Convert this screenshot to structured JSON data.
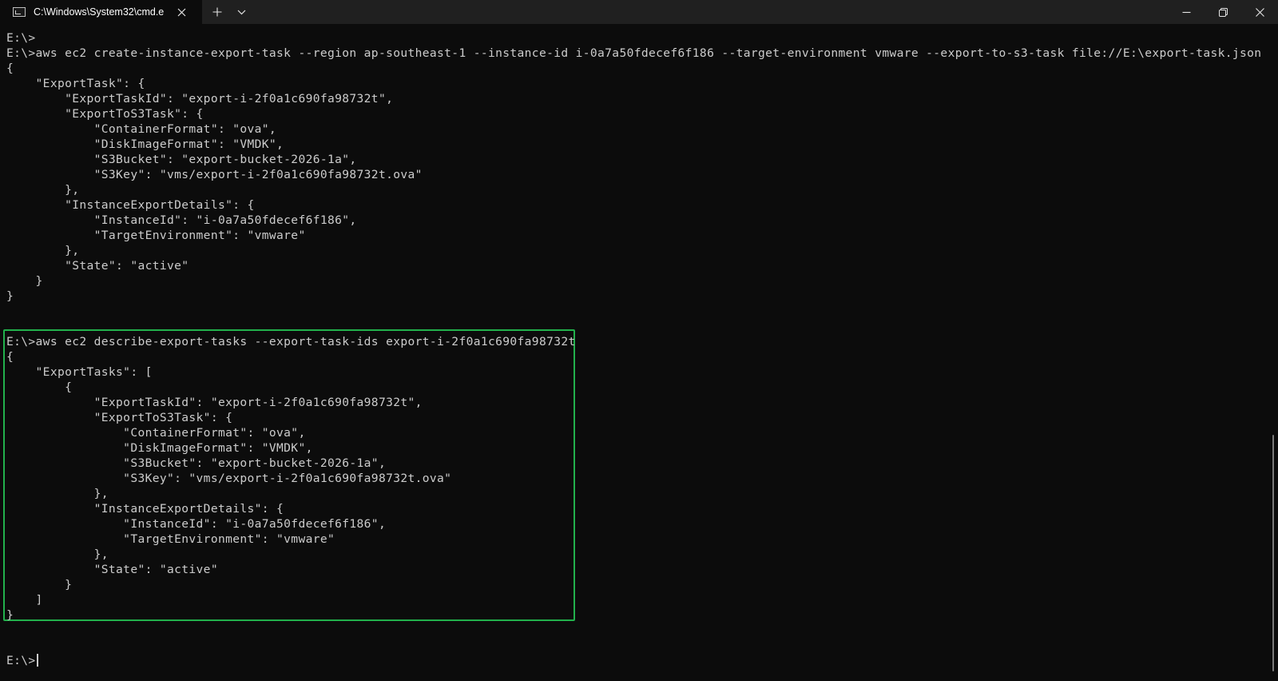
{
  "window": {
    "tab_title": "C:\\Windows\\System32\\cmd.e",
    "icons": {
      "tab": "cmd-icon",
      "close_tab": "close-icon",
      "new_tab": "plus-icon",
      "dropdown": "chevron-down-icon",
      "minimize": "minimize-icon",
      "restore": "restore-icon",
      "close_window": "close-icon"
    }
  },
  "colors": {
    "background": "#0c0c0c",
    "titlebar": "#202020",
    "text": "#cccccc",
    "highlight_border": "#22b14c"
  },
  "terminal": {
    "lines": [
      "E:\\>",
      "E:\\>aws ec2 create-instance-export-task --region ap-southeast-1 --instance-id i-0a7a50fdecef6f186 --target-environment vmware --export-to-s3-task file://E:\\export-task.json",
      "{",
      "    \"ExportTask\": {",
      "        \"ExportTaskId\": \"export-i-2f0a1c690fa98732t\",",
      "        \"ExportToS3Task\": {",
      "            \"ContainerFormat\": \"ova\",",
      "            \"DiskImageFormat\": \"VMDK\",",
      "            \"S3Bucket\": \"export-bucket-2026-1a\",",
      "            \"S3Key\": \"vms/export-i-2f0a1c690fa98732t.ova\"",
      "        },",
      "        \"InstanceExportDetails\": {",
      "            \"InstanceId\": \"i-0a7a50fdecef6f186\",",
      "            \"TargetEnvironment\": \"vmware\"",
      "        },",
      "        \"State\": \"active\"",
      "    }",
      "}",
      "",
      "",
      "E:\\>aws ec2 describe-export-tasks --export-task-ids export-i-2f0a1c690fa98732t",
      "{",
      "    \"ExportTasks\": [",
      "        {",
      "            \"ExportTaskId\": \"export-i-2f0a1c690fa98732t\",",
      "            \"ExportToS3Task\": {",
      "                \"ContainerFormat\": \"ova\",",
      "                \"DiskImageFormat\": \"VMDK\",",
      "                \"S3Bucket\": \"export-bucket-2026-1a\",",
      "                \"S3Key\": \"vms/export-i-2f0a1c690fa98732t.ova\"",
      "            },",
      "            \"InstanceExportDetails\": {",
      "                \"InstanceId\": \"i-0a7a50fdecef6f186\",",
      "                \"TargetEnvironment\": \"vmware\"",
      "            },",
      "            \"State\": \"active\"",
      "        }",
      "    ]",
      "}",
      "",
      "",
      "E:\\>"
    ]
  }
}
